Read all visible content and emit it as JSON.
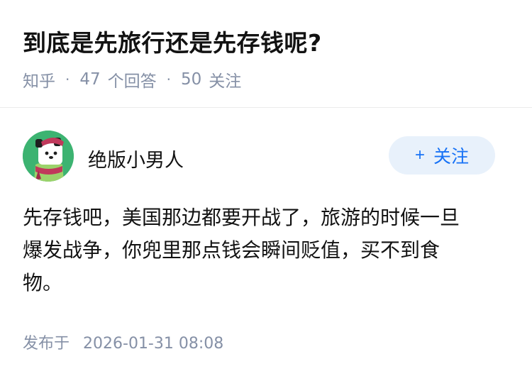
{
  "question": {
    "title": "到底是先旅行还是先存钱呢?",
    "source": "知乎",
    "answer_count": "47",
    "answer_label": "个回答",
    "follow_count": "50",
    "follow_label": "关注"
  },
  "author": {
    "name": "绝版小男人",
    "avatar_icon": "cartoon-animal-avatar",
    "follow_button_label": "关注",
    "follow_button_icon": "plus-icon"
  },
  "answer": {
    "lines": [
      "先存钱吧，美国那边都要开战了，旅游的时候一旦",
      "爆发战争，你兜里那点钱会瞬间贬值，买不到食",
      "物。"
    ]
  },
  "footer": {
    "published_label": "发布于",
    "published_at": "2026-01-31 08:08"
  },
  "colors": {
    "accent": "#1772f6",
    "muted": "#8590a6",
    "follow_bg": "#e8f1fb",
    "avatar_bg": "#3cb371"
  }
}
